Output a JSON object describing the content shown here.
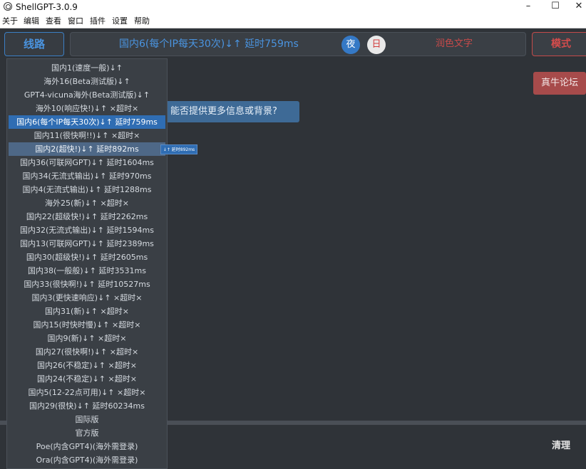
{
  "window": {
    "title": "ShellGPT-3.0.9",
    "controls": {
      "minimize": "–",
      "maximize": "☐",
      "close": "✕"
    }
  },
  "menu": [
    "关于",
    "编辑",
    "查看",
    "窗口",
    "插件",
    "设置",
    "帮助"
  ],
  "topbar": {
    "route_label": "线路",
    "status": "国内6(每个IP每天30次)↓↑ 延时759ms",
    "night_label": "夜",
    "day_label": "日",
    "polish_label": "润色文字",
    "mode_label": "模式"
  },
  "chat": {
    "forum_label": "真牛论坛",
    "bubble_text": "能否提供更多信息或背景?"
  },
  "input": {
    "clear_label": "清理"
  },
  "dropdown": {
    "items": [
      "国内1(速度一般)↓↑",
      "海外16(Beta测试版)↓↑",
      "GPT4-vicuna海外(Beta测试版)↓↑",
      "海外10(响应快!)↓↑ ×超时×",
      "国内6(每个IP每天30次)↓↑ 延时759ms",
      "国内11(很快啊!!)↓↑ ×超时×",
      "国内2(超快!)↓↑ 延时892ms",
      "国内36(可联网GPT)↓↑ 延时1604ms",
      "国内34(无流式输出)↓↑ 延时970ms",
      "国内4(无流式输出)↓↑ 延时1288ms",
      "海外25(新)↓↑ ×超时×",
      "国内22(超级快!)↓↑ 延时2262ms",
      "国内32(无流式输出)↓↑ 延时1594ms",
      "国内13(可联网GPT)↓↑ 延时2389ms",
      "国内30(超级快!)↓↑ 延时2605ms",
      "国内38(一般般)↓↑ 延时3531ms",
      "国内33(很快啊!)↓↑ 延时10527ms",
      "国内3(更快速响应)↓↑ ×超时×",
      "国内31(新)↓↑ ×超时×",
      "国内15(时快时慢)↓↑ ×超时×",
      "国内9(新)↓↑ ×超时×",
      "国内27(很快啊!)↓↑ ×超时×",
      "国内26(不稳定)↓↑ ×超时×",
      "国内24(不稳定)↓↑ ×超时×",
      "国内5(12-22点可用)↓↑ ×超时×",
      "国内29(很快)↓↑ 延时60234ms",
      "国际版",
      "官方版",
      "Poe(内含GPT4)(海外需登录)",
      "Ora(内含GPT4)(海外需登录)"
    ],
    "selected_index": 4,
    "hover_index": 6,
    "tooltip": "↓↑ 延时892ms"
  },
  "colors": {
    "accent": "#3579c6",
    "danger": "#c44a4a",
    "background": "#2f3338"
  }
}
